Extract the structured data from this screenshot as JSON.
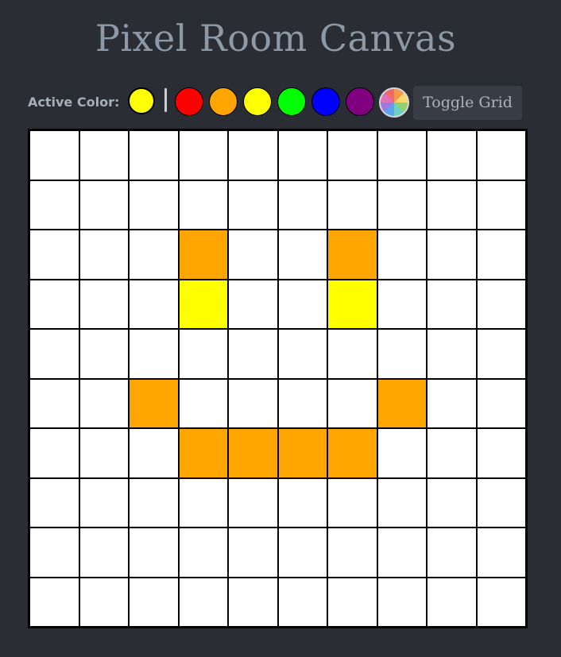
{
  "title": "Pixel Room Canvas",
  "toolbar": {
    "active_label": "Active Color:",
    "active_color": "#ffff00",
    "palette": [
      {
        "name": "red",
        "color": "#ff0000"
      },
      {
        "name": "orange",
        "color": "#ffa500"
      },
      {
        "name": "yellow",
        "color": "#ffff00"
      },
      {
        "name": "green",
        "color": "#00ff00"
      },
      {
        "name": "blue",
        "color": "#0000ff"
      },
      {
        "name": "purple",
        "color": "#800080"
      }
    ],
    "picker_icon": "color-wheel-icon",
    "toggle_grid_label": "Toggle Grid"
  },
  "canvas": {
    "rows": 10,
    "cols": 10,
    "default_color": "#ffffff",
    "grid_color": "#000000",
    "painted": [
      {
        "row": 2,
        "col": 3,
        "color": "#ffa500"
      },
      {
        "row": 2,
        "col": 6,
        "color": "#ffa500"
      },
      {
        "row": 3,
        "col": 3,
        "color": "#ffff00"
      },
      {
        "row": 3,
        "col": 6,
        "color": "#ffff00"
      },
      {
        "row": 5,
        "col": 2,
        "color": "#ffa500"
      },
      {
        "row": 5,
        "col": 7,
        "color": "#ffa500"
      },
      {
        "row": 6,
        "col": 3,
        "color": "#ffa500"
      },
      {
        "row": 6,
        "col": 4,
        "color": "#ffa500"
      },
      {
        "row": 6,
        "col": 5,
        "color": "#ffa500"
      },
      {
        "row": 6,
        "col": 6,
        "color": "#ffa500"
      }
    ]
  }
}
